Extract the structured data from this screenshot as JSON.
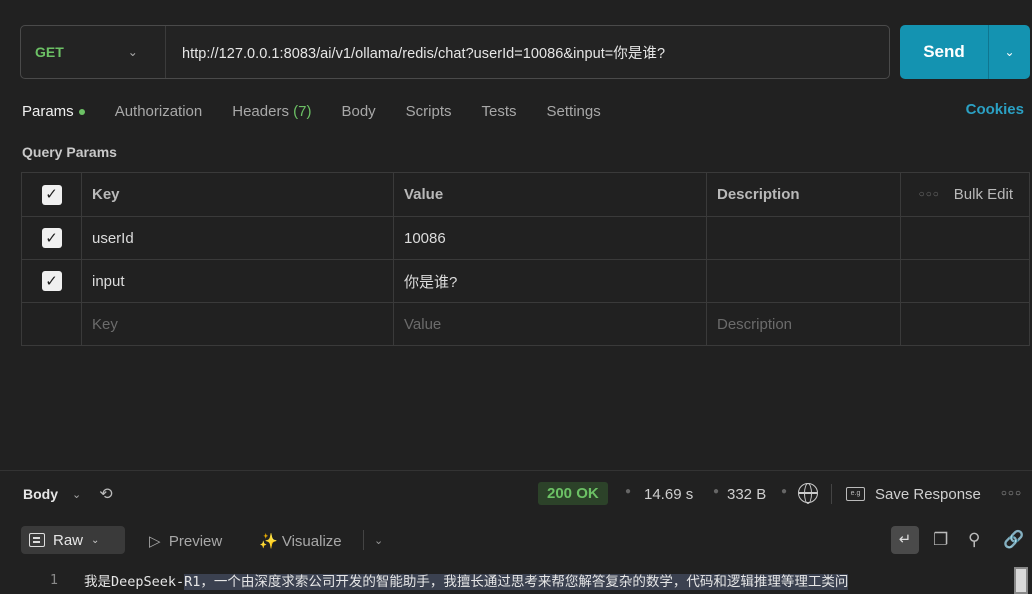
{
  "request": {
    "method": "GET",
    "url": "http://127.0.0.1:8083/ai/v1/ollama/redis/chat?userId=10086&input=你是谁?",
    "send_label": "Send"
  },
  "tabs": {
    "params": "Params",
    "authorization": "Authorization",
    "headers": "Headers",
    "headers_count": "(7)",
    "body": "Body",
    "scripts": "Scripts",
    "tests": "Tests",
    "settings": "Settings",
    "cookies": "Cookies"
  },
  "query_params": {
    "title": "Query Params",
    "columns": {
      "key": "Key",
      "value": "Value",
      "description": "Description",
      "bulk_edit": "Bulk Edit"
    },
    "rows": [
      {
        "key": "userId",
        "value": "10086",
        "description": "",
        "checked": true
      },
      {
        "key": "input",
        "value": "你是谁?",
        "description": "",
        "checked": true
      }
    ],
    "placeholder": {
      "key": "Key",
      "value": "Value",
      "description": "Description"
    }
  },
  "response": {
    "body_tab": "Body",
    "status": "200 OK",
    "time": "14.69 s",
    "size": "332 B",
    "save_label": "Save Response",
    "view_mode": "Raw",
    "preview_label": "Preview",
    "visualize_label": "Visualize",
    "line_number": "1",
    "line_text_prefix": "我是DeepSeek-",
    "line_text_highlight": "R1，一个由深度求索公司开发的智能助手，我擅长通过思考来帮您解答复杂的数学，代码和逻辑推理等理工类问"
  },
  "colors": {
    "accent": "#1493b1",
    "success": "#6cc165",
    "link": "#2ba0c3",
    "background": "#212121"
  }
}
